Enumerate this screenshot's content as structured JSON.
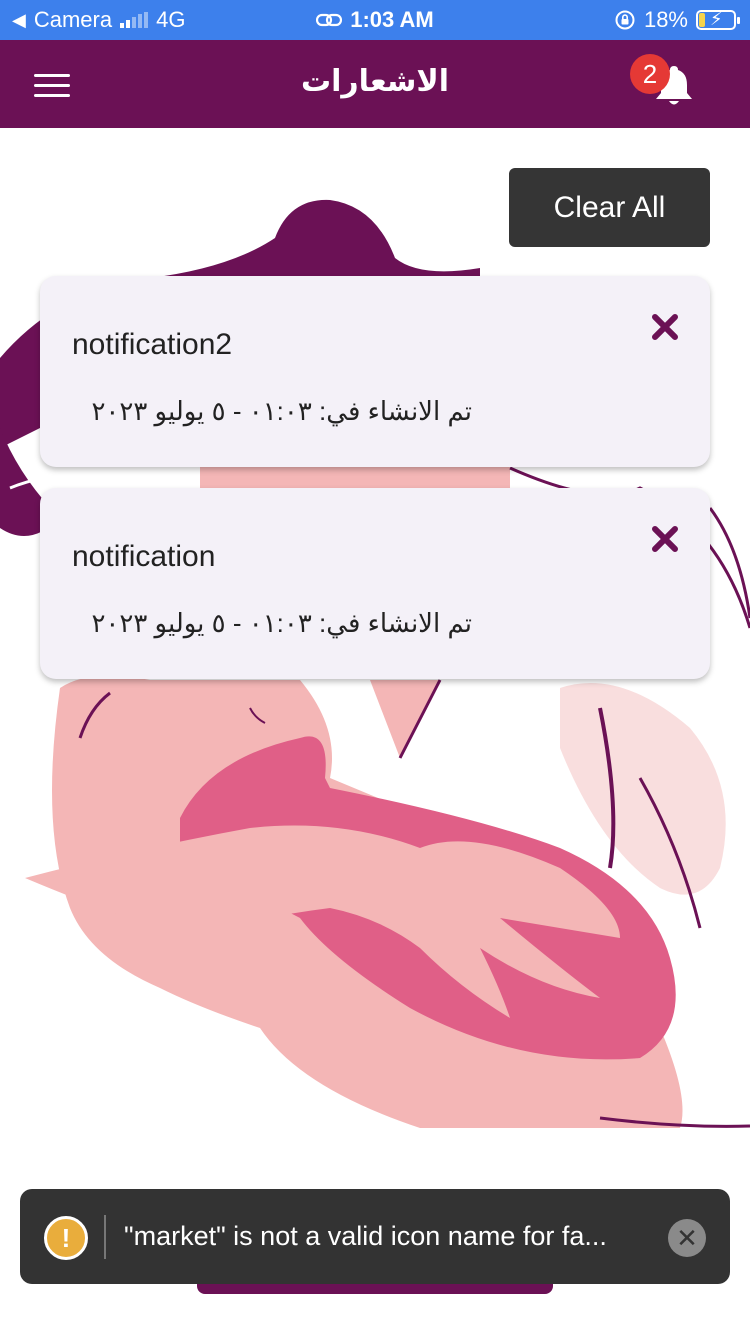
{
  "status_bar": {
    "back_app": "Camera",
    "network": "4G",
    "time": "1:03 AM",
    "battery": "18%",
    "battery_level": 0.18
  },
  "app_bar": {
    "title": "الاشعارات",
    "notification_count": "2"
  },
  "actions": {
    "clear_all": "Clear All"
  },
  "notifications": [
    {
      "title": "notification2",
      "created": "تم الانشاء في: ٠١:٠٣ - ٥ يوليو ٢٠٢٣"
    },
    {
      "title": "notification",
      "created": "تم الانشاء في: ٠١:٠٣ - ٥ يوليو ٢٠٢٣"
    }
  ],
  "toast": {
    "message": "\"market\" is not a valid icon name for fa..."
  },
  "colors": {
    "app_bar": "#6b1155",
    "status_bar": "#3d80ec",
    "badge": "#e53935",
    "card_bg": "#f4f1f8",
    "clear_button": "#353535",
    "toast_bg": "#333333",
    "warning": "#e9ad3c",
    "illustration_dark": "#6b1155",
    "illustration_pink": "#e05f87",
    "illustration_light": "#f4b6b6"
  }
}
